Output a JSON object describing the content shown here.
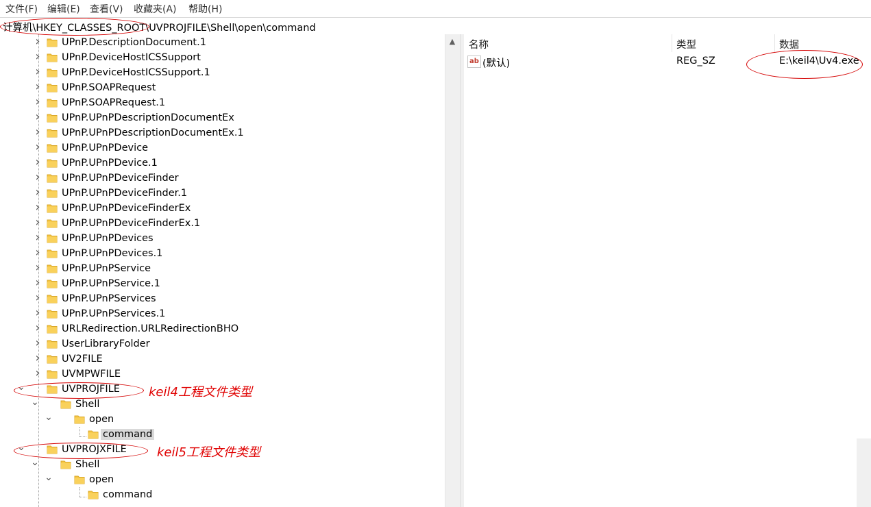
{
  "menu": {
    "items": [
      "文件(F)",
      "编辑(E)",
      "查看(V)",
      "收藏夹(A)",
      "帮助(H)"
    ]
  },
  "address": {
    "path": "计算机\\HKEY_CLASSES_ROOT\\UVPROJFILE\\Shell\\open\\command"
  },
  "tree": {
    "items": [
      {
        "label": "UPnP.DescriptionDocument.1"
      },
      {
        "label": "UPnP.DeviceHostICSSupport"
      },
      {
        "label": "UPnP.DeviceHostICSSupport.1"
      },
      {
        "label": "UPnP.SOAPRequest"
      },
      {
        "label": "UPnP.SOAPRequest.1"
      },
      {
        "label": "UPnP.UPnPDescriptionDocumentEx"
      },
      {
        "label": "UPnP.UPnPDescriptionDocumentEx.1"
      },
      {
        "label": "UPnP.UPnPDevice"
      },
      {
        "label": "UPnP.UPnPDevice.1"
      },
      {
        "label": "UPnP.UPnPDeviceFinder"
      },
      {
        "label": "UPnP.UPnPDeviceFinder.1"
      },
      {
        "label": "UPnP.UPnPDeviceFinderEx"
      },
      {
        "label": "UPnP.UPnPDeviceFinderEx.1"
      },
      {
        "label": "UPnP.UPnPDevices"
      },
      {
        "label": "UPnP.UPnPDevices.1"
      },
      {
        "label": "UPnP.UPnPService"
      },
      {
        "label": "UPnP.UPnPService.1"
      },
      {
        "label": "UPnP.UPnPServices"
      },
      {
        "label": "UPnP.UPnPServices.1"
      },
      {
        "label": "URLRedirection.URLRedirectionBHO"
      },
      {
        "label": "UserLibraryFolder"
      },
      {
        "label": "UV2FILE"
      },
      {
        "label": "UVMPWFILE"
      },
      {
        "label": "UVPROJFILE"
      },
      {
        "label": "Shell"
      },
      {
        "label": "open"
      },
      {
        "label": "command"
      },
      {
        "label": "UVPROJXFILE"
      },
      {
        "label": "Shell"
      },
      {
        "label": "open"
      },
      {
        "label": "command"
      }
    ]
  },
  "list": {
    "columns": {
      "name": "名称",
      "type": "类型",
      "data": "数据"
    },
    "rows": [
      {
        "name": "(默认)",
        "type": "REG_SZ",
        "data": "E:\\keil4\\Uv4.exe",
        "icon": "ab"
      }
    ]
  },
  "annotations": {
    "keil4": "keil4工程文件类型",
    "keil5": "keil5工程文件类型"
  },
  "colors": {
    "annotation": "#d40000",
    "folder": "#f6c744",
    "selected_bg": "#d9d9d9"
  }
}
